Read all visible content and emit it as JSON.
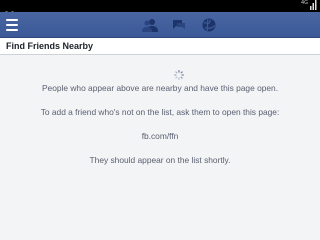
{
  "status_bar": {
    "network_label": "4G",
    "icons": [
      "voicemail-icon",
      "signal-icon"
    ]
  },
  "app_bar": {
    "background_color": "#3b5998",
    "icons": [
      "menu-icon",
      "friend-requests-icon",
      "messages-icon",
      "notifications-icon"
    ]
  },
  "header": {
    "title": "Find Friends Nearby"
  },
  "content": {
    "loading_icon": "spinner-icon",
    "line1": "People who appear above are nearby and have this page open.",
    "line2": "To add a friend who's not on the list, ask them to open this page:",
    "link": "fb.com/ffn",
    "line3": "They should appear on the list shortly."
  }
}
